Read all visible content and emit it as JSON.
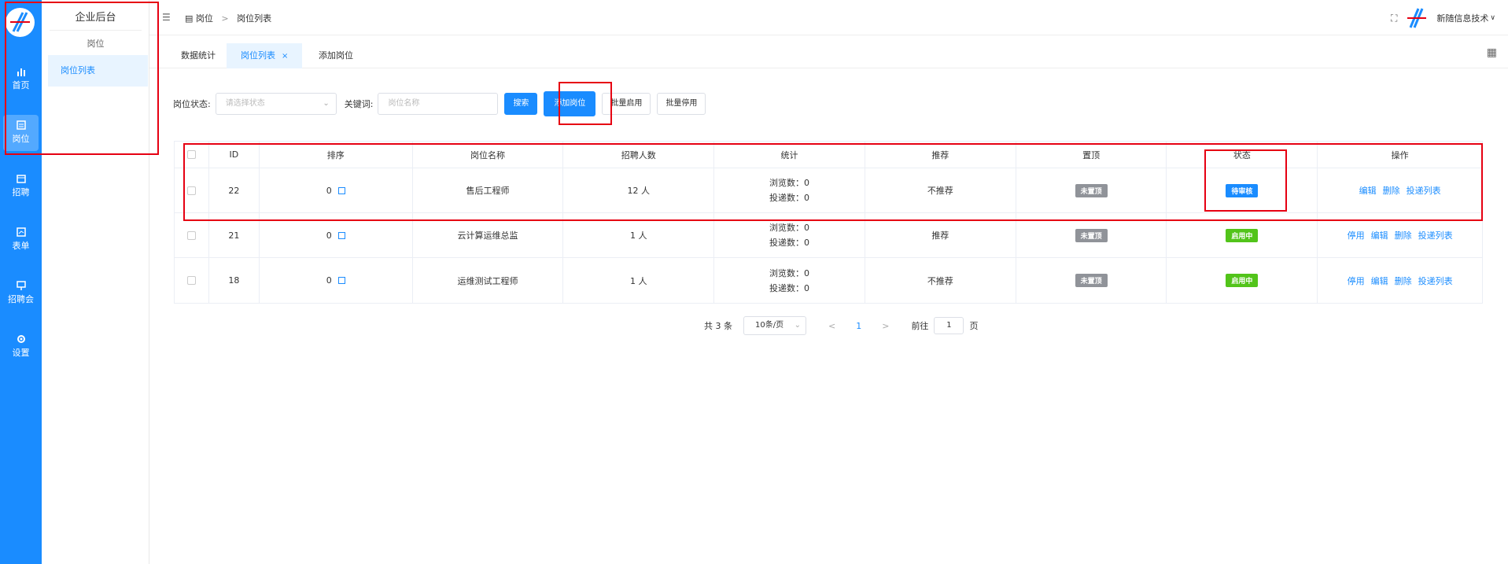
{
  "rail": [
    {
      "icon": "bar-chart-icon",
      "label": "首页"
    },
    {
      "icon": "job-icon",
      "label": "岗位"
    },
    {
      "icon": "recruit-icon",
      "label": "招聘"
    },
    {
      "icon": "form-icon",
      "label": "表单"
    },
    {
      "icon": "job-fair-icon",
      "label": "招聘会"
    },
    {
      "icon": "gear-icon",
      "label": "设置"
    }
  ],
  "subside": {
    "title": "企业后台",
    "group": "岗位",
    "item": "岗位列表"
  },
  "breadcrumb": {
    "root": "岗位",
    "sep": ">",
    "current": "岗位列表"
  },
  "company": {
    "name": "新随信息技术",
    "chev": "∨"
  },
  "tabs": [
    {
      "label": "数据统计"
    },
    {
      "label": "岗位列表",
      "close": "×"
    },
    {
      "label": "添加岗位"
    }
  ],
  "filter": {
    "status_label": "岗位状态:",
    "status_placeholder": "请选择状态",
    "keyword_label": "关键词:",
    "keyword_placeholder": "岗位名称",
    "search": "搜索",
    "add": "添加岗位",
    "batch_enable": "批量启用",
    "batch_disable": "批量停用"
  },
  "table": {
    "headers": {
      "id": "ID",
      "sort": "排序",
      "name": "岗位名称",
      "num": "招聘人数",
      "stat": "统计",
      "rec": "推荐",
      "top": "置顶",
      "status": "状态",
      "op": "操作"
    },
    "rows": [
      {
        "id": "22",
        "sort": "0",
        "name": "售后工程师",
        "num": "12 人",
        "views": "浏览数：0",
        "applies": "投递数：0",
        "rec": "不推荐",
        "top": "未置顶",
        "status": "待审核",
        "ops": [
          "编辑",
          "删除",
          "投递列表"
        ]
      },
      {
        "id": "21",
        "sort": "0",
        "name": "云计算运维总监",
        "num": "1 人",
        "views": "浏览数：0",
        "applies": "投递数：0",
        "rec": "推荐",
        "top": "未置顶",
        "status": "启用中",
        "ops": [
          "停用",
          "编辑",
          "删除",
          "投递列表"
        ]
      },
      {
        "id": "18",
        "sort": "0",
        "name": "运维测试工程师",
        "num": "1 人",
        "views": "浏览数：0",
        "applies": "投递数：0",
        "rec": "不推荐",
        "top": "未置顶",
        "status": "启用中",
        "ops": [
          "停用",
          "编辑",
          "删除",
          "投递列表"
        ]
      }
    ]
  },
  "pager": {
    "total": "共 3 条",
    "size": "10条/页",
    "prev": "<",
    "page": "1",
    "next": ">",
    "goto": "前往",
    "jump": "1",
    "unit": "页"
  },
  "colors": {
    "primary": "#1a8cff",
    "success": "#52c41a",
    "gray_tag": "#909399",
    "highlight": "#e60012"
  }
}
